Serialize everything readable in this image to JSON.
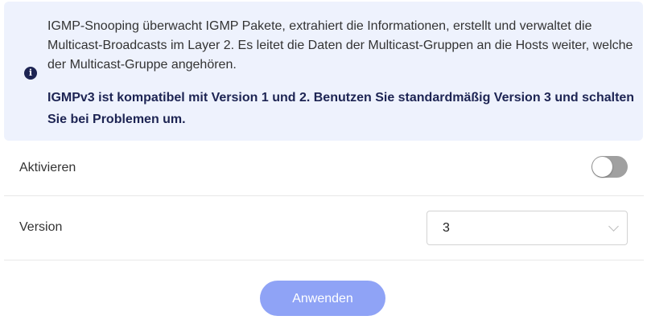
{
  "info": {
    "icon": "info-circle-icon",
    "text": "IGMP-Snooping überwacht IGMP Pakete, extrahiert die Informationen, erstellt und verwaltet die Multicast-Broadcasts im Layer 2. Es leitet die Daten der Multicast-Gruppen an die Hosts weiter, welche der Multicast-Gruppe angehören.",
    "bold_text": "IGMPv3 ist kompatibel mit Version 1 und 2. Benutzen Sie standardmäßig Version 3 und schalten Sie bei Problemen um."
  },
  "enable": {
    "label": "Aktivieren",
    "on": false
  },
  "version": {
    "label": "Version",
    "value": "3"
  },
  "apply_label": "Anwenden",
  "colors": {
    "accent": "#8fa3f6",
    "info_bg": "#eef2fd",
    "toggle_off": "#a0a0a0"
  }
}
